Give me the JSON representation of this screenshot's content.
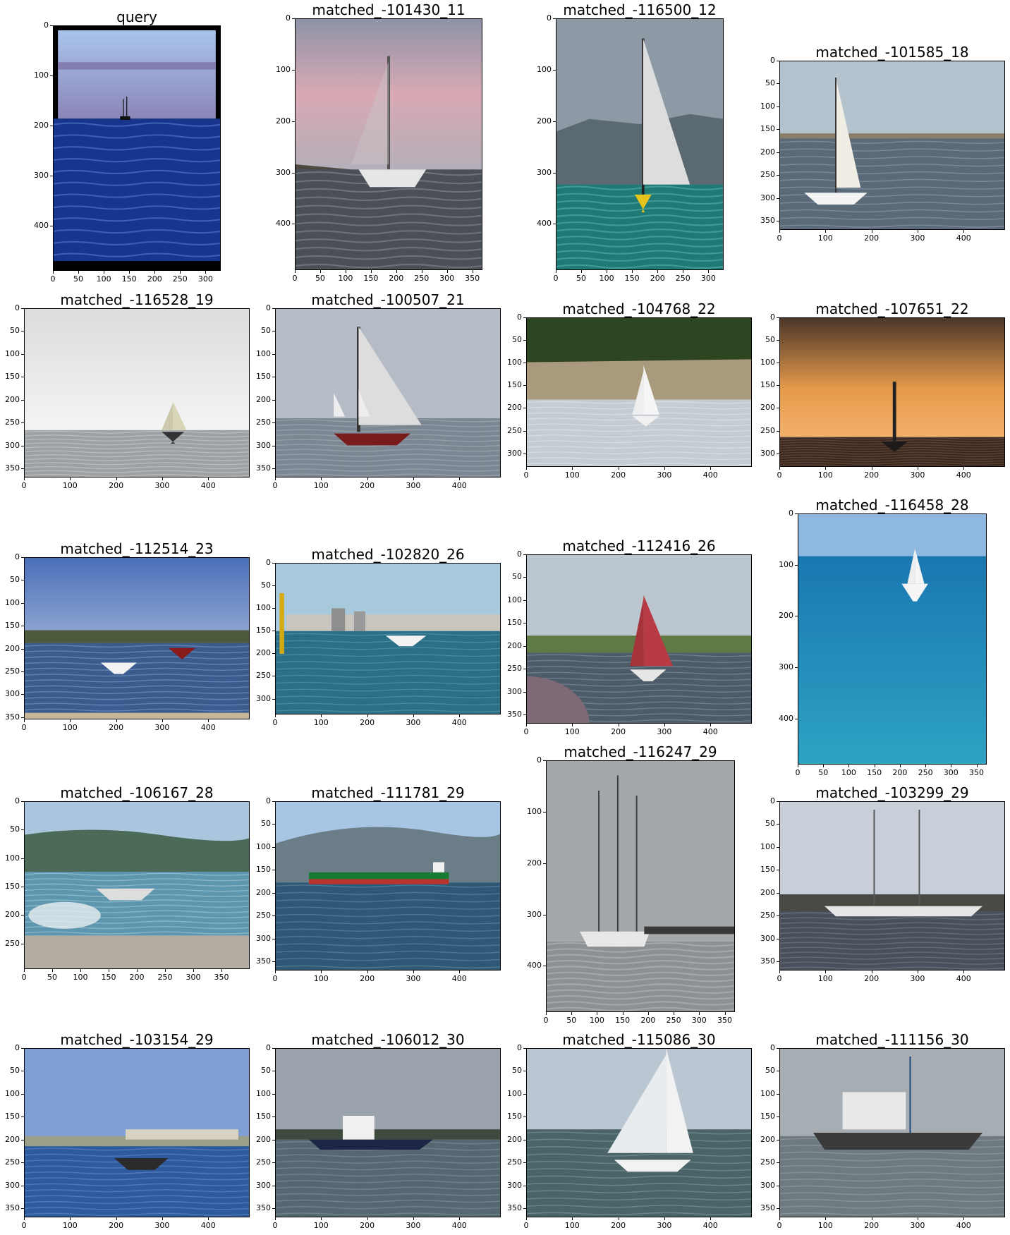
{
  "figure": {
    "panels": [
      {
        "title": "query",
        "scene": "ocean-night",
        "xticks": [
          "0",
          "50",
          "100",
          "150",
          "200",
          "250",
          "300"
        ],
        "yticks": [
          "0",
          "100",
          "200",
          "300",
          "400"
        ]
      },
      {
        "title": "matched_-101430_11",
        "scene": "pink-sailboat",
        "xticks": [
          "0",
          "50",
          "100",
          "150",
          "200",
          "250",
          "300",
          "350"
        ],
        "yticks": [
          "0",
          "100",
          "200",
          "300",
          "400"
        ]
      },
      {
        "title": "matched_-116500_12",
        "scene": "teal-mountain",
        "xticks": [
          "0",
          "50",
          "100",
          "150",
          "200",
          "250",
          "300"
        ],
        "yticks": [
          "0",
          "100",
          "200",
          "300",
          "400"
        ]
      },
      {
        "title": "matched_-101585_18",
        "scene": "bay-sailboat",
        "xticks": [
          "0",
          "100",
          "200",
          "300",
          "400"
        ],
        "yticks": [
          "0",
          "50",
          "100",
          "150",
          "200",
          "250",
          "300",
          "350"
        ]
      },
      {
        "title": "matched_-116528_19",
        "scene": "fog-sail",
        "xticks": [
          "0",
          "100",
          "200",
          "300",
          "400"
        ],
        "yticks": [
          "0",
          "50",
          "100",
          "150",
          "200",
          "250",
          "300",
          "350"
        ]
      },
      {
        "title": "matched_-100507_21",
        "scene": "harbor-fleet",
        "xticks": [
          "0",
          "100",
          "200",
          "300",
          "400"
        ],
        "yticks": [
          "0",
          "50",
          "100",
          "150",
          "200",
          "250",
          "300",
          "350"
        ]
      },
      {
        "title": "matched_-104768_22",
        "scene": "cliff-sail",
        "xticks": [
          "0",
          "100",
          "200",
          "300",
          "400"
        ],
        "yticks": [
          "0",
          "50",
          "100",
          "150",
          "200",
          "250",
          "300"
        ]
      },
      {
        "title": "matched_-107651_22",
        "scene": "sunset-sail",
        "xticks": [
          "0",
          "100",
          "200",
          "300",
          "400"
        ],
        "yticks": [
          "0",
          "50",
          "100",
          "150",
          "200",
          "250",
          "300"
        ]
      },
      {
        "title": "matched_-112514_23",
        "scene": "blue-bay",
        "xticks": [
          "0",
          "100",
          "200",
          "300",
          "400"
        ],
        "yticks": [
          "0",
          "50",
          "100",
          "150",
          "200",
          "250",
          "300",
          "350"
        ]
      },
      {
        "title": "matched_-102820_26",
        "scene": "city-harbor",
        "xticks": [
          "0",
          "100",
          "200",
          "300",
          "400"
        ],
        "yticks": [
          "0",
          "50",
          "100",
          "150",
          "200",
          "250",
          "300"
        ]
      },
      {
        "title": "matched_-112416_26",
        "scene": "red-sail",
        "xticks": [
          "0",
          "100",
          "200",
          "300",
          "400"
        ],
        "yticks": [
          "0",
          "50",
          "100",
          "150",
          "200",
          "250",
          "300",
          "350"
        ]
      },
      {
        "title": "matched_-116458_28",
        "scene": "tropical-sea",
        "xticks": [
          "0",
          "50",
          "100",
          "150",
          "200",
          "250",
          "300",
          "350"
        ],
        "yticks": [
          "0",
          "100",
          "200",
          "300",
          "400"
        ]
      },
      {
        "title": "matched_-106167_28",
        "scene": "wave-beach",
        "xticks": [
          "0",
          "50",
          "100",
          "150",
          "200",
          "250",
          "300",
          "350"
        ],
        "yticks": [
          "0",
          "50",
          "100",
          "150",
          "200",
          "250"
        ]
      },
      {
        "title": "matched_-111781_29",
        "scene": "cargo-ship",
        "xticks": [
          "0",
          "100",
          "200",
          "300",
          "400"
        ],
        "yticks": [
          "0",
          "50",
          "100",
          "150",
          "200",
          "250",
          "300",
          "350"
        ]
      },
      {
        "title": "matched_-116247_29",
        "scene": "fog-tallship",
        "xticks": [
          "0",
          "50",
          "100",
          "150",
          "200",
          "250",
          "300",
          "350"
        ],
        "yticks": [
          "0",
          "100",
          "200",
          "300",
          "400"
        ]
      },
      {
        "title": "matched_-103299_29",
        "scene": "yacht-dock",
        "xticks": [
          "0",
          "100",
          "200",
          "300",
          "400"
        ],
        "yticks": [
          "0",
          "50",
          "100",
          "150",
          "200",
          "250",
          "300",
          "350"
        ]
      },
      {
        "title": "matched_-103154_29",
        "scene": "palm-canoe",
        "xticks": [
          "0",
          "100",
          "200",
          "300",
          "400"
        ],
        "yticks": [
          "0",
          "50",
          "100",
          "150",
          "200",
          "250",
          "300",
          "350"
        ]
      },
      {
        "title": "matched_-106012_30",
        "scene": "trawler",
        "xticks": [
          "0",
          "100",
          "200",
          "300",
          "400"
        ],
        "yticks": [
          "0",
          "50",
          "100",
          "150",
          "200",
          "250",
          "300",
          "350"
        ]
      },
      {
        "title": "matched_-115086_30",
        "scene": "racing-sail",
        "xticks": [
          "0",
          "100",
          "200",
          "300",
          "400"
        ],
        "yticks": [
          "0",
          "50",
          "100",
          "150",
          "200",
          "250",
          "300",
          "350"
        ]
      },
      {
        "title": "matched_-111156_30",
        "scene": "fishing-boat",
        "xticks": [
          "0",
          "100",
          "200",
          "300",
          "400"
        ],
        "yticks": [
          "0",
          "50",
          "100",
          "150",
          "200",
          "250",
          "300",
          "350"
        ]
      }
    ]
  }
}
